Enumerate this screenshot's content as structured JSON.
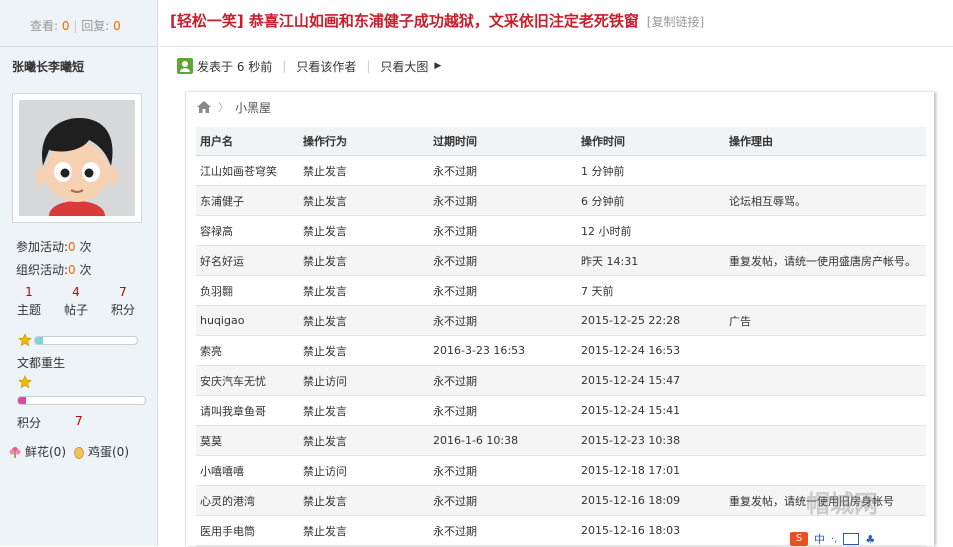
{
  "left": {
    "view_label": "查看:",
    "view_count": "0",
    "reply_label": "回复:",
    "reply_count": "0",
    "username": "张曦长李曦短",
    "activity_join_label": "参加活动:",
    "activity_join_count": "0",
    "activity_join_unit": "次",
    "activity_org_label": "组织活动:",
    "activity_org_count": "0",
    "activity_org_unit": "次",
    "stats": [
      {
        "value": "1",
        "label": "主题"
      },
      {
        "value": "4",
        "label": "帖子"
      },
      {
        "value": "7",
        "label": "积分"
      }
    ],
    "level_progress": 0.08,
    "rank_name": "文都重生",
    "rank_progress": 0.06,
    "points_label": "积分",
    "points_value": "7",
    "flower": "鲜花(0)",
    "egg": "鸡蛋(0)"
  },
  "post": {
    "title": "[轻松一笑] 恭喜江山如画和东浦健子成功越狱，文采依旧注定老死铁窗",
    "copy_link": "[复制链接]",
    "posted": "发表于 6 秒前",
    "only_author": "只看该作者",
    "big_image": "只看大图"
  },
  "panel": {
    "breadcrumb": "小黑屋",
    "columns": [
      "用户名",
      "操作行为",
      "过期时间",
      "操作时间",
      "操作理由"
    ],
    "rows": [
      [
        "江山如画苍穹笑",
        "禁止发言",
        "永不过期",
        "1 分钟前",
        ""
      ],
      [
        "东浦健子",
        "禁止发言",
        "永不过期",
        "6 分钟前",
        "论坛相互辱骂。"
      ],
      [
        "容禄高",
        "禁止发言",
        "永不过期",
        "12 小时前",
        ""
      ],
      [
        "好名好运",
        "禁止发言",
        "永不过期",
        "昨天 14:31",
        "重复发帖，请统一使用盛唐房产帐号。"
      ],
      [
        "负羽翾",
        "禁止发言",
        "永不过期",
        "7 天前",
        ""
      ],
      [
        "huqigao",
        "禁止发言",
        "永不过期",
        "2015-12-25 22:28",
        "广告"
      ],
      [
        "索亮",
        "禁止发言",
        "2016-3-23 16:53",
        "2015-12-24 16:53",
        ""
      ],
      [
        "安庆汽车无忧",
        "禁止访问",
        "永不过期",
        "2015-12-24 15:47",
        ""
      ],
      [
        "请叫我章鱼哥",
        "禁止发言",
        "永不过期",
        "2015-12-24 15:41",
        ""
      ],
      [
        "莫莫",
        "禁止发言",
        "2016-1-6 10:38",
        "2015-12-23 10:38",
        ""
      ],
      [
        "小嘻嘻嘻",
        "禁止访问",
        "永不过期",
        "2015-12-18 17:01",
        ""
      ],
      [
        "心灵的港湾",
        "禁止发言",
        "永不过期",
        "2015-12-16 18:09",
        "重复发帖，请统一使用旧房身帐号"
      ],
      [
        "医用手电筒",
        "禁止发言",
        "永不过期",
        "2015-12-16 18:03",
        ""
      ]
    ]
  },
  "watermark": "帽城网",
  "tray": {
    "ime": "S",
    "lang": "中"
  },
  "colors": {
    "title_red": "#c81d2b",
    "accent_orange": "#ff6600",
    "level_fill": "#7fd3dc",
    "rank_fill": "#e8449b"
  }
}
